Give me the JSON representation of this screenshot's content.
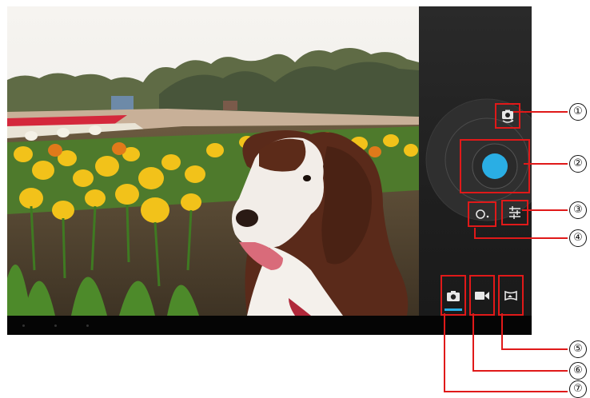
{
  "camera_ui": {
    "controls": {
      "switch_camera": "switch-camera-icon",
      "shutter": "shutter-button",
      "settings": "settings-sliders-icon",
      "more": "more-options-icon"
    },
    "modes": [
      {
        "name": "photo-mode",
        "icon": "camera-icon",
        "selected": true
      },
      {
        "name": "video-mode",
        "icon": "video-camera-icon",
        "selected": false
      },
      {
        "name": "panorama-mode",
        "icon": "panorama-icon",
        "selected": false
      }
    ],
    "accent_color": "#2aaee4",
    "highlight_color": "#e01919"
  },
  "callout_labels": [
    "①",
    "②",
    "③",
    "④",
    "⑤",
    "⑥",
    "⑦"
  ]
}
